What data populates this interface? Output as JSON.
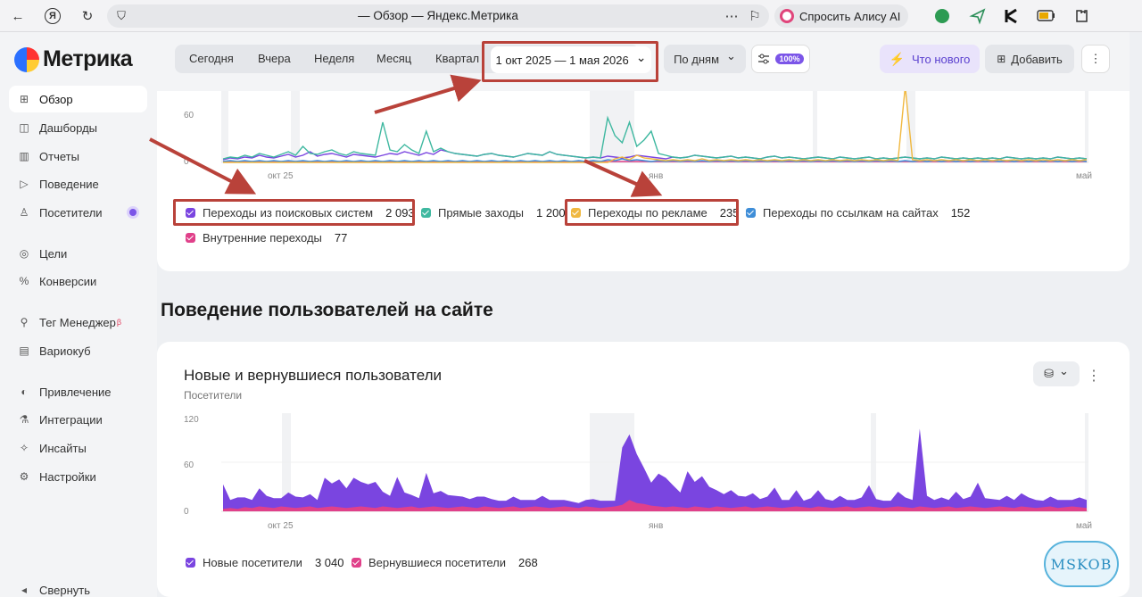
{
  "browser": {
    "title": "— Обзор — Яндекс.Метрика",
    "alice_label": "Спросить Алису AI",
    "back_icon": "←",
    "yandex_icon": "Я",
    "reload_icon": "↻",
    "shield_icon": "⛉",
    "menu_icon": "⋯",
    "bookmark_icon": "⚐"
  },
  "sidebar": {
    "logo": "Метрика",
    "items": [
      {
        "label": "Обзор",
        "icon": "⊞"
      },
      {
        "label": "Дашборды",
        "icon": "◫"
      },
      {
        "label": "Отчеты",
        "icon": "▥"
      },
      {
        "label": "Поведение",
        "icon": "▷"
      },
      {
        "label": "Посетители",
        "icon": "♙"
      },
      {
        "label": "Цели",
        "icon": "◎"
      },
      {
        "label": "Конверсии",
        "icon": "%"
      },
      {
        "label": "Тег Менеджер",
        "icon": "⚲",
        "beta": "β"
      },
      {
        "label": "Вариокуб",
        "icon": "▤"
      },
      {
        "label": "Привлечение",
        "icon": "◐"
      },
      {
        "label": "Интеграции",
        "icon": "⚗"
      },
      {
        "label": "Инсайты",
        "icon": "✧"
      },
      {
        "label": "Настройки",
        "icon": "⚙"
      }
    ],
    "collapse_label": "Свернуть",
    "collapse_icon": "◂"
  },
  "toolbar": {
    "periods": [
      "Сегодня",
      "Вчера",
      "Неделя",
      "Месяц",
      "Квартал"
    ],
    "date_range": "1 окт 2025 — 1 мая 2026",
    "date_chevron": "⌄",
    "group_by": "По дням",
    "filter_badge": "100%",
    "whats_new": "Что нового",
    "add": "Добавить",
    "more_icon": "⋮"
  },
  "colors": {
    "purple": "#7a45e0",
    "green": "#3fb8a0",
    "yellow": "#f0b840",
    "blue": "#3f8ed8",
    "pink": "#e0408a",
    "annotation_red": "#b9423a"
  },
  "traffic_card": {
    "y_ticks": [
      "60",
      "0"
    ],
    "x_ticks": [
      "окт 25",
      "янв",
      "май"
    ],
    "legend": [
      {
        "label": "Переходы из поисковых систем",
        "value": "2 093",
        "color": "#7a45e0"
      },
      {
        "label": "Прямые заходы",
        "value": "1 200",
        "color": "#3fb8a0"
      },
      {
        "label": "Переходы по рекламе",
        "value": "235",
        "color": "#f0b840"
      },
      {
        "label": "Переходы по ссылкам на сайтах",
        "value": "152",
        "color": "#3f8ed8"
      },
      {
        "label": "Внутренние переходы",
        "value": "77",
        "color": "#e0408a"
      }
    ]
  },
  "section_title": "Поведение пользователей на сайте",
  "users_card": {
    "title": "Новые и вернувшиеся пользователи",
    "subtitle": "Посетители",
    "more_icon": "⋮",
    "db_icon": "⛁",
    "chevron": "⌄",
    "legend": [
      {
        "label": "Новые посетители",
        "value": "3 040",
        "color": "#7a45e0"
      },
      {
        "label": "Вернувшиеся посетители",
        "value": "268",
        "color": "#e0408a"
      }
    ]
  },
  "chart_data": [
    {
      "type": "line",
      "x_ticks": [
        "окт 25",
        "янв",
        "май"
      ],
      "ylim": [
        0,
        80
      ],
      "y_ticks": [
        0,
        60
      ],
      "series": [
        {
          "name": "Переходы из поисковых систем",
          "values": [
            3,
            5,
            4,
            6,
            5,
            8,
            6,
            5,
            7,
            9,
            6,
            8,
            12,
            7,
            9,
            10,
            8,
            6,
            9,
            8,
            7,
            6,
            8,
            10,
            9,
            12,
            10,
            8,
            11,
            9,
            14,
            12,
            10,
            9,
            8,
            7,
            9,
            10,
            8,
            7,
            6,
            8,
            10,
            9,
            8,
            12,
            9,
            8,
            7,
            6,
            5,
            6,
            5,
            7,
            6,
            5,
            6,
            8,
            7,
            6,
            5,
            4,
            6,
            5,
            6,
            8,
            7,
            6,
            5,
            6,
            7,
            5,
            6,
            5,
            4,
            6,
            7,
            5,
            6,
            5,
            4,
            5,
            6,
            5,
            4,
            6,
            5,
            4,
            5,
            6,
            4,
            5,
            4,
            5,
            6,
            5,
            4,
            5,
            4,
            6,
            5,
            4,
            5,
            4,
            5,
            4,
            5,
            4,
            6,
            5,
            4,
            5,
            4,
            5,
            4,
            6,
            5,
            4,
            5,
            4
          ]
        },
        {
          "name": "Прямые заходы",
          "values": [
            4,
            6,
            5,
            8,
            6,
            10,
            8,
            6,
            9,
            12,
            8,
            18,
            10,
            9,
            12,
            14,
            10,
            8,
            12,
            10,
            9,
            8,
            45,
            14,
            12,
            20,
            14,
            10,
            35,
            12,
            16,
            12,
            10,
            9,
            8,
            7,
            9,
            10,
            8,
            7,
            6,
            8,
            10,
            9,
            8,
            12,
            9,
            8,
            7,
            6,
            5,
            6,
            5,
            50,
            30,
            22,
            45,
            18,
            25,
            35,
            10,
            8,
            6,
            5,
            6,
            8,
            7,
            6,
            5,
            6,
            7,
            5,
            6,
            5,
            4,
            6,
            7,
            5,
            6,
            5,
            4,
            5,
            6,
            5,
            4,
            6,
            5,
            4,
            5,
            6,
            4,
            5,
            4,
            5,
            6,
            5,
            4,
            5,
            4,
            6,
            5,
            4,
            5,
            4,
            5,
            4,
            5,
            4,
            6,
            5,
            4,
            5,
            4,
            5,
            4,
            6,
            5,
            4,
            5,
            4
          ]
        },
        {
          "name": "Переходы по рекламе",
          "values": [
            0,
            0,
            0,
            0,
            0,
            0,
            0,
            0,
            0,
            0,
            0,
            0,
            0,
            0,
            0,
            0,
            0,
            0,
            0,
            0,
            0,
            0,
            0,
            0,
            0,
            0,
            0,
            0,
            0,
            0,
            0,
            0,
            0,
            0,
            0,
            0,
            0,
            0,
            0,
            0,
            0,
            0,
            0,
            0,
            0,
            0,
            0,
            0,
            0,
            0,
            0,
            0,
            0,
            0,
            4,
            6,
            3,
            8,
            5,
            4,
            3,
            2,
            3,
            2,
            3,
            2,
            4,
            2,
            3,
            2,
            3,
            2,
            3,
            2,
            3,
            2,
            3,
            2,
            3,
            2,
            3,
            2,
            3,
            2,
            3,
            2,
            3,
            2,
            3,
            2,
            3,
            2,
            3,
            2,
            85,
            3,
            2,
            3,
            2,
            3,
            2,
            3,
            2,
            3,
            2,
            3,
            2,
            3,
            2,
            3,
            2,
            3,
            2,
            3,
            2,
            3,
            2,
            3,
            2,
            3
          ]
        },
        {
          "name": "Переходы по ссылкам на сайтах",
          "values": [
            1,
            2,
            1,
            2,
            1,
            2,
            1,
            2,
            1,
            2,
            1,
            2,
            1,
            2,
            1,
            2,
            1,
            2,
            1,
            2,
            1,
            2,
            1,
            2,
            1,
            2,
            1,
            2,
            1,
            2,
            1,
            2,
            1,
            2,
            1,
            2,
            1,
            2,
            1,
            2,
            1,
            2,
            1,
            2,
            1,
            2,
            1,
            2,
            1,
            2,
            1,
            2,
            1,
            3,
            2,
            4,
            2,
            3,
            2,
            1,
            2,
            1,
            2,
            1,
            2,
            1,
            2,
            1,
            2,
            1,
            2,
            1,
            2,
            1,
            2,
            1,
            2,
            1,
            2,
            1,
            2,
            1,
            2,
            1,
            2,
            1,
            2,
            1,
            2,
            1,
            2,
            1,
            2,
            1,
            2,
            1,
            2,
            1,
            2,
            1,
            2,
            1,
            2,
            1,
            2,
            1,
            2,
            1,
            2,
            1,
            2,
            1,
            2,
            1,
            2,
            1,
            2,
            1,
            2,
            1
          ]
        },
        {
          "name": "Внутренние переходы",
          "values": [
            1,
            1,
            1,
            1,
            1,
            1,
            1,
            1,
            1,
            1,
            1,
            1,
            1,
            1,
            1,
            1,
            1,
            1,
            1,
            1,
            1,
            1,
            1,
            1,
            1,
            1,
            1,
            1,
            1,
            1,
            1,
            1,
            1,
            1,
            1,
            1,
            1,
            1,
            1,
            1,
            1,
            1,
            1,
            1,
            1,
            1,
            1,
            1,
            1,
            1,
            1,
            1,
            1,
            1,
            1,
            1,
            1,
            1,
            1,
            1,
            1,
            1,
            1,
            1,
            1,
            1,
            1,
            1,
            1,
            1,
            1,
            1,
            1,
            1,
            1,
            1,
            1,
            1,
            1,
            1,
            1,
            1,
            1,
            1,
            1,
            1,
            1,
            1,
            1,
            1,
            1,
            1,
            1,
            1,
            1,
            1,
            1,
            1,
            1,
            1,
            1,
            1,
            1,
            1,
            1,
            1,
            1,
            1,
            1,
            1,
            1,
            1,
            1,
            1,
            1,
            1,
            1,
            1,
            1,
            1
          ]
        }
      ]
    },
    {
      "type": "area",
      "title": "Новые и вернувшиеся пользователи",
      "ylabel": "Посетители",
      "x_ticks": [
        "окт 25",
        "янв",
        "май"
      ],
      "ylim": [
        0,
        120
      ],
      "y_ticks": [
        0,
        60,
        120
      ],
      "series": [
        {
          "name": "Новые посетители",
          "values": [
            30,
            10,
            14,
            12,
            10,
            22,
            14,
            12,
            10,
            18,
            14,
            12,
            15,
            10,
            36,
            28,
            34,
            24,
            36,
            30,
            28,
            32,
            18,
            14,
            38,
            18,
            14,
            12,
            42,
            16,
            20,
            16,
            14,
            12,
            10,
            14,
            12,
            10,
            9,
            8,
            12,
            10,
            9,
            8,
            14,
            10,
            9,
            8,
            7,
            6,
            8,
            10,
            9,
            8,
            7,
            70,
            80,
            60,
            44,
            28,
            40,
            36,
            26,
            18,
            45,
            30,
            38,
            26,
            20,
            16,
            22,
            14,
            12,
            18,
            10,
            12,
            24,
            10,
            9,
            20,
            8,
            12,
            20,
            10,
            9,
            14,
            8,
            10,
            12,
            26,
            10,
            9,
            8,
            18,
            12,
            10,
            95,
            14,
            10,
            12,
            8,
            20,
            10,
            12,
            30,
            12,
            10,
            8,
            14,
            10,
            16,
            12,
            10,
            8,
            12,
            10,
            9,
            8,
            12,
            10
          ]
        },
        {
          "name": "Вернувшиеся посетители",
          "values": [
            3,
            4,
            3,
            5,
            4,
            6,
            5,
            4,
            6,
            5,
            4,
            5,
            6,
            4,
            5,
            6,
            5,
            4,
            5,
            6,
            5,
            4,
            6,
            5,
            4,
            5,
            6,
            4,
            5,
            6,
            5,
            4,
            5,
            6,
            5,
            4,
            6,
            5,
            4,
            5,
            6,
            4,
            5,
            6,
            5,
            4,
            5,
            6,
            5,
            4,
            6,
            5,
            4,
            5,
            6,
            8,
            14,
            10,
            9,
            7,
            6,
            5,
            6,
            5,
            4,
            6,
            5,
            4,
            6,
            5,
            4,
            5,
            6,
            4,
            5,
            6,
            5,
            4,
            5,
            6,
            5,
            4,
            6,
            5,
            4,
            5,
            6,
            4,
            5,
            6,
            5,
            4,
            5,
            6,
            5,
            4,
            6,
            5,
            4,
            5,
            6,
            4,
            5,
            6,
            5,
            4,
            5,
            6,
            5,
            4,
            6,
            5,
            4,
            5,
            6,
            4,
            5,
            6,
            5,
            4
          ]
        }
      ]
    }
  ]
}
